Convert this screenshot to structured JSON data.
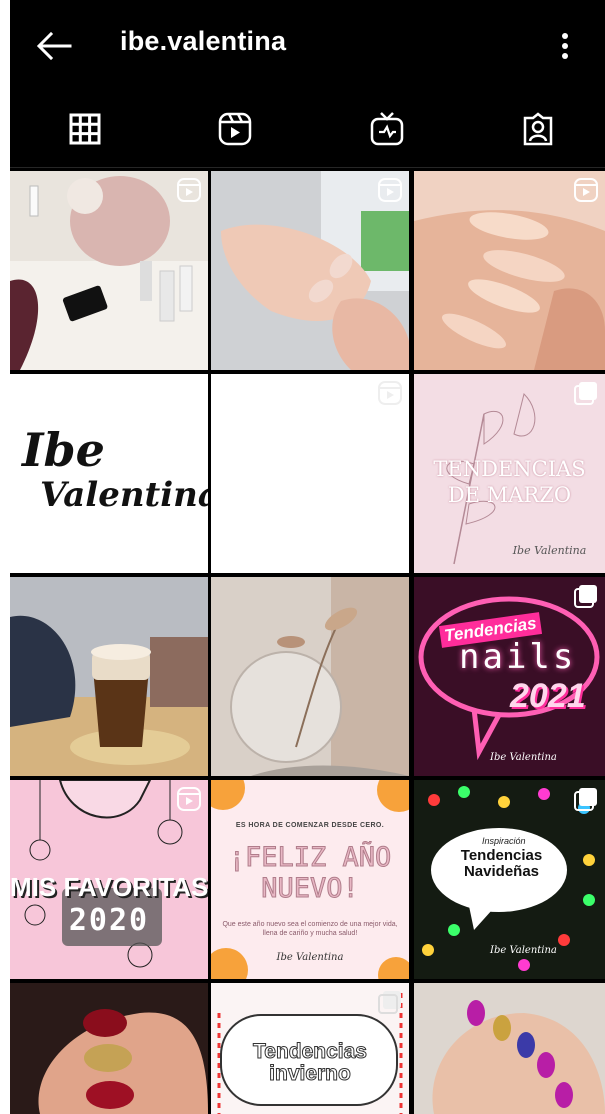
{
  "header": {
    "title": "ibe.valentina",
    "back_icon": "arrow-left-icon",
    "menu_icon": "more-vertical-icon"
  },
  "tabs": [
    {
      "name": "posts-grid",
      "icon": "grid-icon",
      "active": true
    },
    {
      "name": "reels",
      "icon": "reels-icon",
      "active": false
    },
    {
      "name": "igtv",
      "icon": "igtv-icon",
      "active": false
    },
    {
      "name": "tagged",
      "icon": "tagged-person-icon",
      "active": false
    }
  ],
  "posts": {
    "logo_text": "Ibe Valentina",
    "tendencias_marzo": "TENDENCIAS DE MARZO",
    "tendencias_marzo_line1": "TENDENCIAS",
    "tendencias_marzo_line2": "DE MARZO",
    "signature": "Ibe Valentina",
    "neon_title": "Tendencias",
    "neon_nails": "nails",
    "neon_year": "2021",
    "favoritas_line1": "MIS FAVORITAS",
    "favoritas_line2": "2020",
    "feliz_top": "ES HORA DE COMENZAR DESDE CERO.",
    "feliz_line1": "¡FELIZ AÑO",
    "feliz_line2": "NUEVO!",
    "feliz_bottom": "Que este año nuevo sea el comienzo de una mejor vida, llena de cariño y mucha salud!",
    "navidad_small": "Inspiración",
    "navidad_line1": "Tendencias",
    "navidad_line2": "Navideñas",
    "invierno_line1": "Tendencias",
    "invierno_line2": "invierno"
  },
  "colors": {
    "background": "#000000",
    "text": "#ffffff",
    "neon_pink": "#ff2d9b",
    "pastel_pink": "#f7c6d9"
  }
}
